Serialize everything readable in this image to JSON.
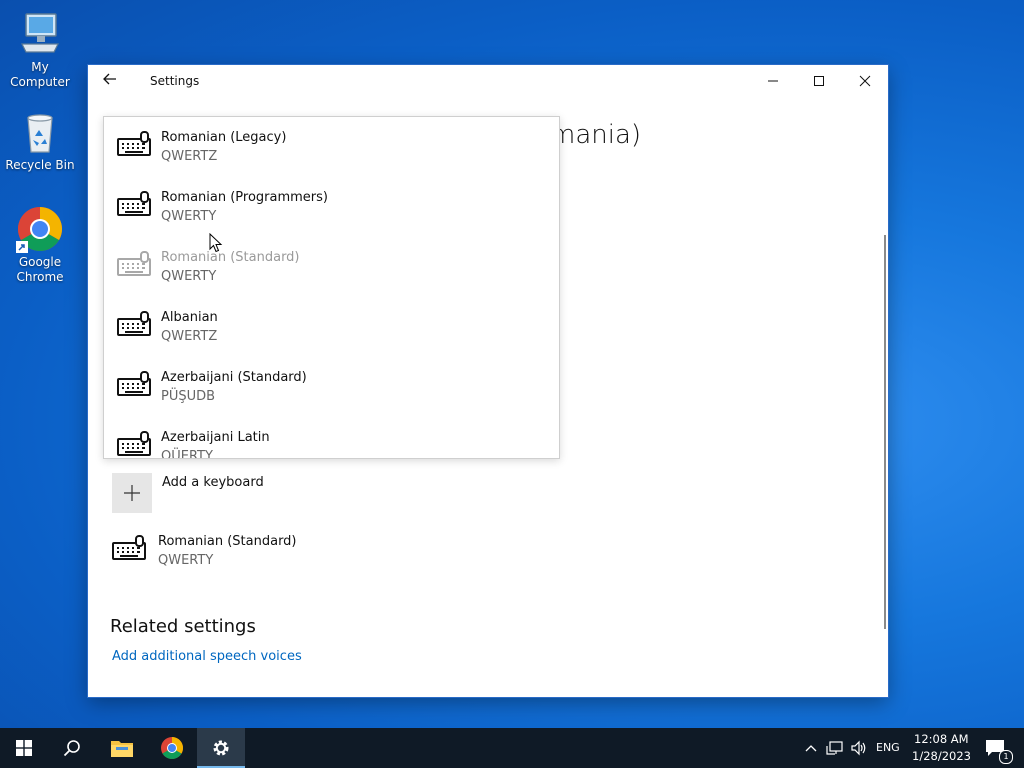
{
  "desktop": {
    "icons": [
      {
        "label": "My Computer",
        "icon": "computer-icon"
      },
      {
        "label": "Recycle Bin",
        "icon": "recycle-bin-icon"
      },
      {
        "label": "Google Chrome",
        "icon": "chrome-icon"
      }
    ]
  },
  "window": {
    "title": "Settings",
    "heading_visible_fragment": "mania)",
    "add_keyboard_label": "Add a keyboard",
    "installed_keyboard": {
      "name": "Romanian (Standard)",
      "layout": "QWERTY"
    },
    "related_settings_heading": "Related settings",
    "speech_voices_link": "Add additional speech voices"
  },
  "dropdown": {
    "items": [
      {
        "name": "Romanian (Legacy)",
        "layout": "QWERTZ",
        "disabled": false
      },
      {
        "name": "Romanian (Programmers)",
        "layout": "QWERTY",
        "disabled": false
      },
      {
        "name": "Romanian (Standard)",
        "layout": "QWERTY",
        "disabled": true
      },
      {
        "name": "Albanian",
        "layout": "QWERTZ",
        "disabled": false
      },
      {
        "name": "Azerbaijani (Standard)",
        "layout": "PÜŞUDB",
        "disabled": false
      },
      {
        "name": "Azerbaijani Latin",
        "layout": "QÜERTY",
        "disabled": false
      }
    ]
  },
  "taskbar": {
    "language": "ENG",
    "time": "12:08 AM",
    "date": "1/28/2023",
    "notification_count": "1"
  },
  "colors": {
    "accent_link": "#0067c0",
    "taskbar_bg": "#0f1a26"
  }
}
